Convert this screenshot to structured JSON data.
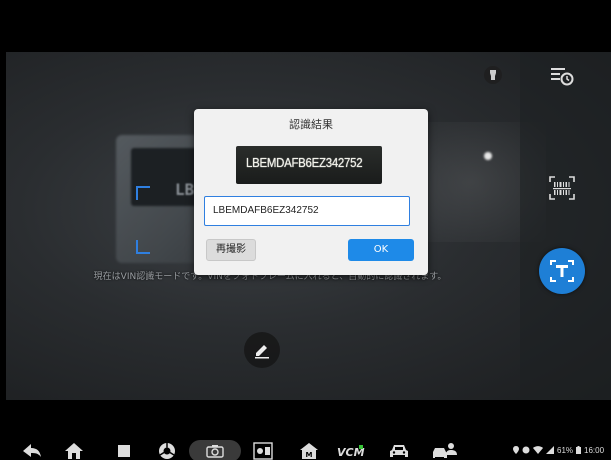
{
  "dialog": {
    "title": "認識結果",
    "image_text": "LBEMDAFB6EZ342752",
    "input_value": "LBEMDAFB6EZ342752",
    "retake_label": "再撮影",
    "ok_label": "OK"
  },
  "camera": {
    "instruction": "現在はVIN認識モードです。VINをフォトフレームに入れると、自動的に認識されます。",
    "bg_card_text": "LBE"
  },
  "status": {
    "battery": "61%",
    "time": "16:00"
  },
  "colors": {
    "accent": "#1e8ae8",
    "frame": "#2f7fe0"
  },
  "icons": {
    "flash": "flashlight-icon",
    "history": "history-icon",
    "barcode": "barcode-scan-icon",
    "ocr": "text-recognition-icon",
    "edit": "pencil-icon"
  }
}
